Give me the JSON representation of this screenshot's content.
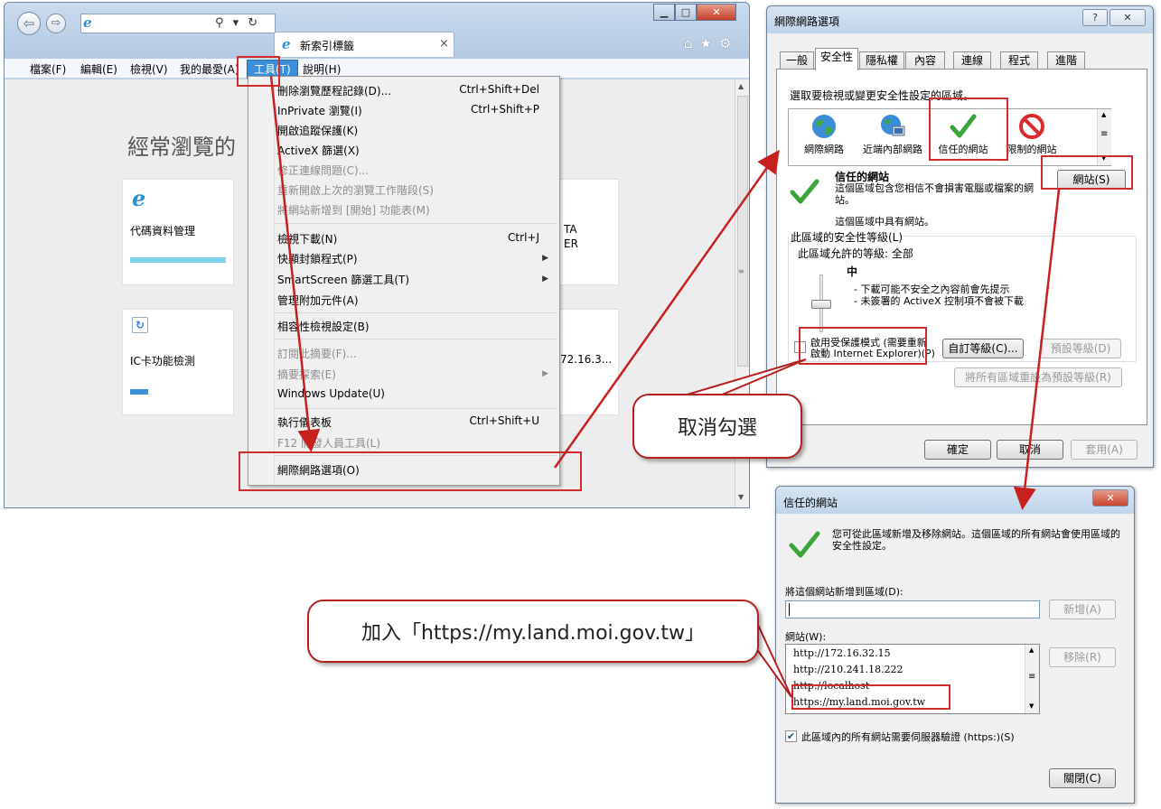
{
  "ie": {
    "tab_title": "新索引標籤",
    "tab_close": "×",
    "menu": [
      "檔案(F)",
      "編輯(E)",
      "檢視(V)",
      "我的最愛(A)",
      "工具(T)",
      "說明(H)"
    ],
    "nav_back_icon": "back-arrow-icon",
    "nav_forward_icon": "forward-arrow-icon",
    "addr_icons": "⚲ ▾ ↻",
    "toolbar_icons": "⌂★⚙",
    "win_min": "▁",
    "win_max": "□",
    "win_close": "✕",
    "content": {
      "heading": "經常瀏覽的",
      "tiles": [
        {
          "title": "代碼資料管理",
          "bar_color": "#7fd2ec"
        },
        {
          "title": "IC卡功能檢測",
          "bar_color": "#3a8fdd"
        }
      ],
      "partial_text_1": "TA",
      "partial_text_2": "ER",
      "partial_text_3": "72.16.3..."
    }
  },
  "tools_menu": {
    "items": [
      {
        "label": "刪除瀏覽歷程記錄(D)...",
        "shortcut": "Ctrl+Shift+Del",
        "disabled": false
      },
      {
        "label": "InPrivate 瀏覽(I)",
        "shortcut": "Ctrl+Shift+P",
        "disabled": false
      },
      {
        "label": "開啟追蹤保護(K)",
        "shortcut": "",
        "disabled": false
      },
      {
        "label": "ActiveX 篩選(X)",
        "shortcut": "",
        "disabled": false
      },
      {
        "label": "修正連線問題(C)...",
        "shortcut": "",
        "disabled": true
      },
      {
        "label": "重新開啟上次的瀏覽工作階段(S)",
        "shortcut": "",
        "disabled": true
      },
      {
        "label": "將網站新增到 [開始] 功能表(M)",
        "shortcut": "",
        "disabled": true
      },
      {
        "label": "檢視下載(N)",
        "shortcut": "Ctrl+J",
        "disabled": false
      },
      {
        "label": "快顯封鎖程式(P)",
        "shortcut": "",
        "disabled": false
      },
      {
        "label": "SmartScreen 篩選工具(T)",
        "shortcut": "",
        "disabled": false
      },
      {
        "label": "管理附加元件(A)",
        "shortcut": "",
        "disabled": false
      },
      {
        "label": "相容性檢視設定(B)",
        "shortcut": "",
        "disabled": false
      },
      {
        "label": "訂閱此摘要(F)...",
        "shortcut": "",
        "disabled": true
      },
      {
        "label": "摘要探索(E)",
        "shortcut": "",
        "disabled": true
      },
      {
        "label": "Windows Update(U)",
        "shortcut": "",
        "disabled": false
      },
      {
        "label": "執行儀表板",
        "shortcut": "Ctrl+Shift+U",
        "disabled": false
      },
      {
        "label": "F12 開發人員工具(L)",
        "shortcut": "",
        "disabled": true
      },
      {
        "label": "網際網路選項(O)",
        "shortcut": "",
        "disabled": false
      }
    ],
    "submenu_arrow": "▶"
  },
  "options_dialog": {
    "title": "網際網路選項",
    "help_btn": "?",
    "close_btn": "✕",
    "tabs": [
      "一般",
      "安全性",
      "隱私權",
      "內容",
      "連線",
      "程式",
      "進階"
    ],
    "selected_tab": "安全性",
    "zone_prompt": "選取要檢視或變更安全性設定的區域。",
    "zones": [
      {
        "label": "網際網路",
        "icon": "globe-icon"
      },
      {
        "label": "近端內部網路",
        "icon": "intranet-icon"
      },
      {
        "label": "信任的網站",
        "icon": "checkmark-icon"
      },
      {
        "label": "限制的網站",
        "icon": "prohibited-icon"
      }
    ],
    "zone_title": "信任的網站",
    "zone_desc": "這個區域包含您相信不會損害電腦或檔案的網站。",
    "zone_has_sites": "這個區域中具有網站。",
    "sites_button": "網站(S)",
    "security_level_label": "此區域的安全性等級(L)",
    "allowed_levels": "此區域允許的等級: 全部",
    "level_name": "中",
    "level_bullets": [
      "- 下載可能不安全之內容前會先提示",
      "- 未簽署的 ActiveX 控制項不會被下載"
    ],
    "protected_mode_label": "啟用受保護模式 (需要重新啟動 Internet Explorer)(P)",
    "custom_level_btn": "自訂等級(C)...",
    "default_level_btn": "預設等級(D)",
    "reset_all_btn": "將所有區域重設為預設等級(R)",
    "ok_btn": "確定",
    "cancel_btn": "取消",
    "apply_btn": "套用(A)",
    "accent_green": "#3aa33a",
    "accent_red": "#d92b2b"
  },
  "trusted_dialog": {
    "title": "信任的網站",
    "close_btn": "✕",
    "desc": "您可從此區域新增及移除網站。這個區域的所有網站會使用區域的安全性設定。",
    "add_label": "將這個網站新增到區域(D):",
    "add_value": "",
    "add_btn": "新增(A)",
    "sites_label": "網站(W):",
    "sites": [
      "http://172.16.32.15",
      "http://210.241.18.222",
      "http://localhost",
      "https://my.land.moi.gov.tw"
    ],
    "remove_btn": "移除(R)",
    "https_check_label": "此區域內的所有網站需要伺服器驗證 (https:)(S)",
    "https_checked": true,
    "close_btn_label": "關閉(C)"
  },
  "annotations": {
    "uncheck_callout": "取消勾選",
    "add_callout": "加入「https://my.land.moi.gov.tw」",
    "color": "#c8201e"
  }
}
